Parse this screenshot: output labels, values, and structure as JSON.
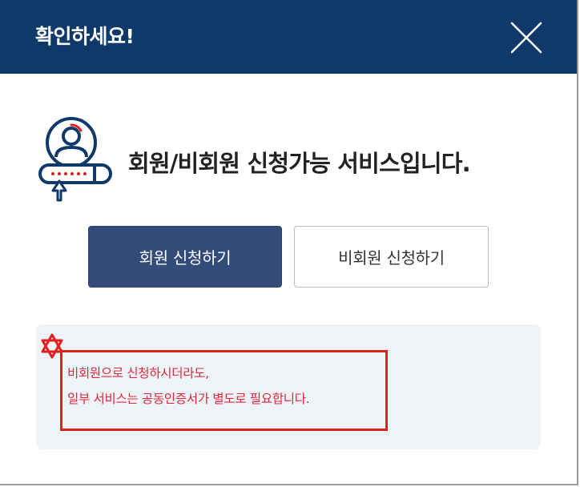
{
  "dialog": {
    "title": "확인하세요!",
    "close_icon": "close-x-icon",
    "header_color": "#0e3968"
  },
  "main": {
    "icon": "user-login-icon",
    "headline": "회원/비회원 신청가능 서비스입니다."
  },
  "buttons": {
    "member_label": "회원 신청하기",
    "guest_label": "비회원 신청하기",
    "member_color": "#334c7a"
  },
  "notice": {
    "icon": "star-icon",
    "line1": "비회원으로 신청하시더라도,",
    "line2": "일부 서비스는 공동인증서가 별도로 필요합니다.",
    "text_color": "#e0283a",
    "highlight_color": "#e02020"
  }
}
